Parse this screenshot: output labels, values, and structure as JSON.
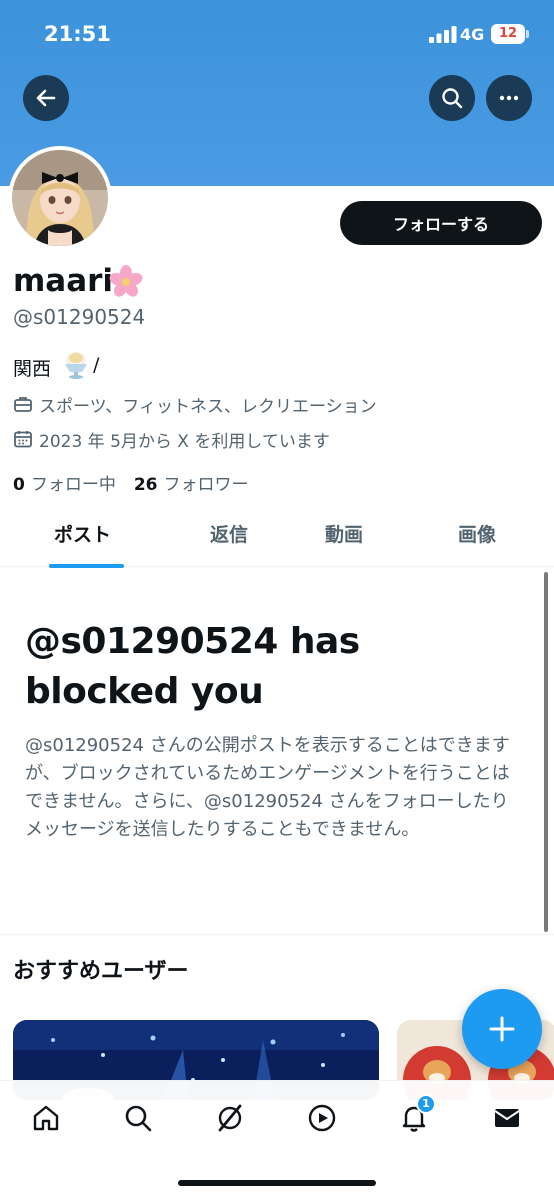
{
  "status_bar": {
    "time": "21:51",
    "network": "4G",
    "battery": "12"
  },
  "header": {
    "back_icon": "arrow-left-icon",
    "search_icon": "search-icon",
    "more_icon": "more-horizontal-icon"
  },
  "profile": {
    "display_name": "maari",
    "name_emoji": "cherry-blossom",
    "handle": "@s01290524",
    "bio": "関西",
    "bio_emoji": "shaved-ice",
    "bio_suffix": "/",
    "category": "スポーツ、フィットネス、レクリエーション",
    "joined": "2023 年 5月から X を利用しています",
    "following_count": "0",
    "following_label": "フォロー中",
    "followers_count": "26",
    "followers_label": "フォロワー",
    "follow_button": "フォローする"
  },
  "tabs": [
    {
      "label": "ポスト",
      "active": true
    },
    {
      "label": "返信",
      "active": false
    },
    {
      "label": "動画",
      "active": false
    },
    {
      "label": "画像",
      "active": false
    }
  ],
  "blocked": {
    "title": "@s01290524 has blocked you",
    "description": "@s01290524 さんの公開ポストを表示することはできますが、ブロックされているためエンゲージメントを行うことはできません。さらに、@s01290524 さんをフォローしたりメッセージを送信したりすることもできません。"
  },
  "recommendations": {
    "title": "おすすめユーザー"
  },
  "bottom_nav": {
    "items": [
      {
        "icon": "home-icon"
      },
      {
        "icon": "search-icon"
      },
      {
        "icon": "grok-icon"
      },
      {
        "icon": "play-icon"
      },
      {
        "icon": "bell-icon",
        "badge": "1"
      },
      {
        "icon": "mail-icon"
      }
    ]
  },
  "colors": {
    "banner": "#3c93da",
    "accent": "#1d9bf0",
    "text": "#0f1419",
    "muted": "#536471"
  }
}
